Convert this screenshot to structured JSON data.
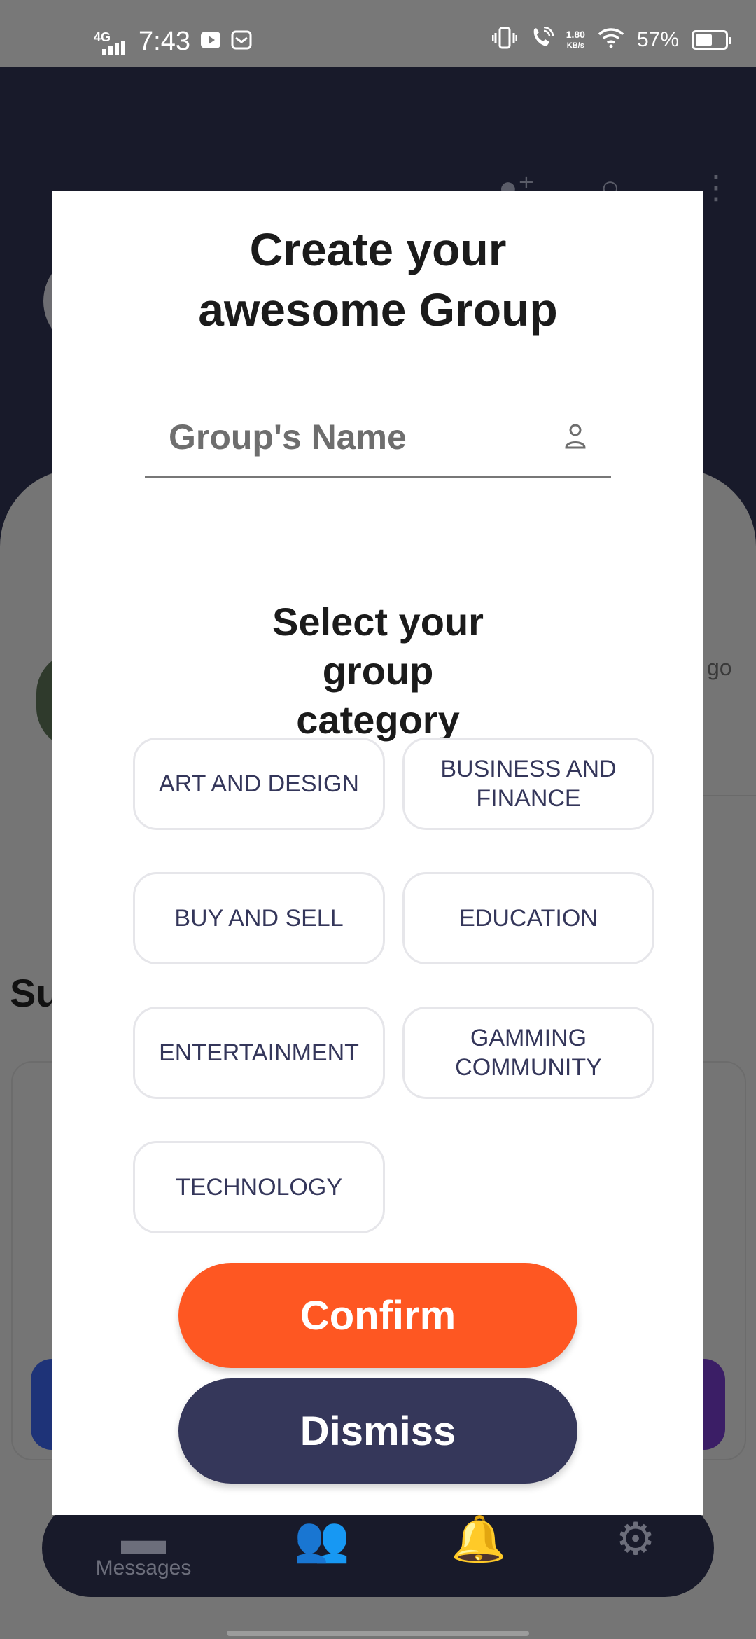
{
  "status_bar": {
    "network": "4G",
    "time": "7:43",
    "speed_value": "1.80",
    "speed_unit": "KB/s",
    "battery": "57%",
    "battery_level": 0.57
  },
  "background": {
    "partial_time": "go",
    "partial_heading": "Su",
    "nav_label_messages": "Messages"
  },
  "dialog": {
    "title": "Create your awesome Group",
    "name_placeholder": "Group's Name",
    "name_value": "",
    "category_heading": "Select your group category",
    "categories": [
      "ART AND DESIGN",
      "BUSINESS AND FINANCE",
      "BUY AND SELL",
      "EDUCATION",
      "ENTERTAINMENT",
      "GAMMING COMMUNITY",
      "TECHNOLOGY"
    ],
    "confirm_label": "Confirm",
    "dismiss_label": "Dismiss"
  },
  "colors": {
    "confirm": "#fe5722",
    "dismiss": "#35375a",
    "chip_text": "#34365a",
    "chip_border": "#e6e6ea"
  }
}
